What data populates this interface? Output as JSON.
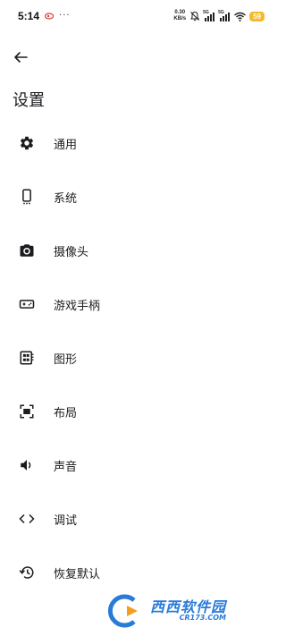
{
  "status_bar": {
    "time": "5:14",
    "dots": "···",
    "net_speed_value": "0.30",
    "net_speed_unit": "KB/s",
    "sim1_label": "5G",
    "sim2_label": "5G",
    "battery": "59"
  },
  "header": {
    "title": "设置"
  },
  "menu": {
    "items": [
      {
        "label": "通用",
        "icon": "gear-icon"
      },
      {
        "label": "系统",
        "icon": "phone-icon"
      },
      {
        "label": "摄像头",
        "icon": "camera-icon"
      },
      {
        "label": "游戏手柄",
        "icon": "gamepad-icon"
      },
      {
        "label": "图形",
        "icon": "graphics-icon"
      },
      {
        "label": "布局",
        "icon": "layout-icon"
      },
      {
        "label": "声音",
        "icon": "volume-icon"
      },
      {
        "label": "调试",
        "icon": "code-icon"
      },
      {
        "label": "恢复默认",
        "icon": "restore-icon"
      }
    ]
  },
  "watermark": {
    "main": "西西软件园",
    "sub": "CR173.COM"
  },
  "colors": {
    "accent": "#1c1b1f",
    "battery": "#f5b92a",
    "watermark": "#2a7bd8"
  }
}
